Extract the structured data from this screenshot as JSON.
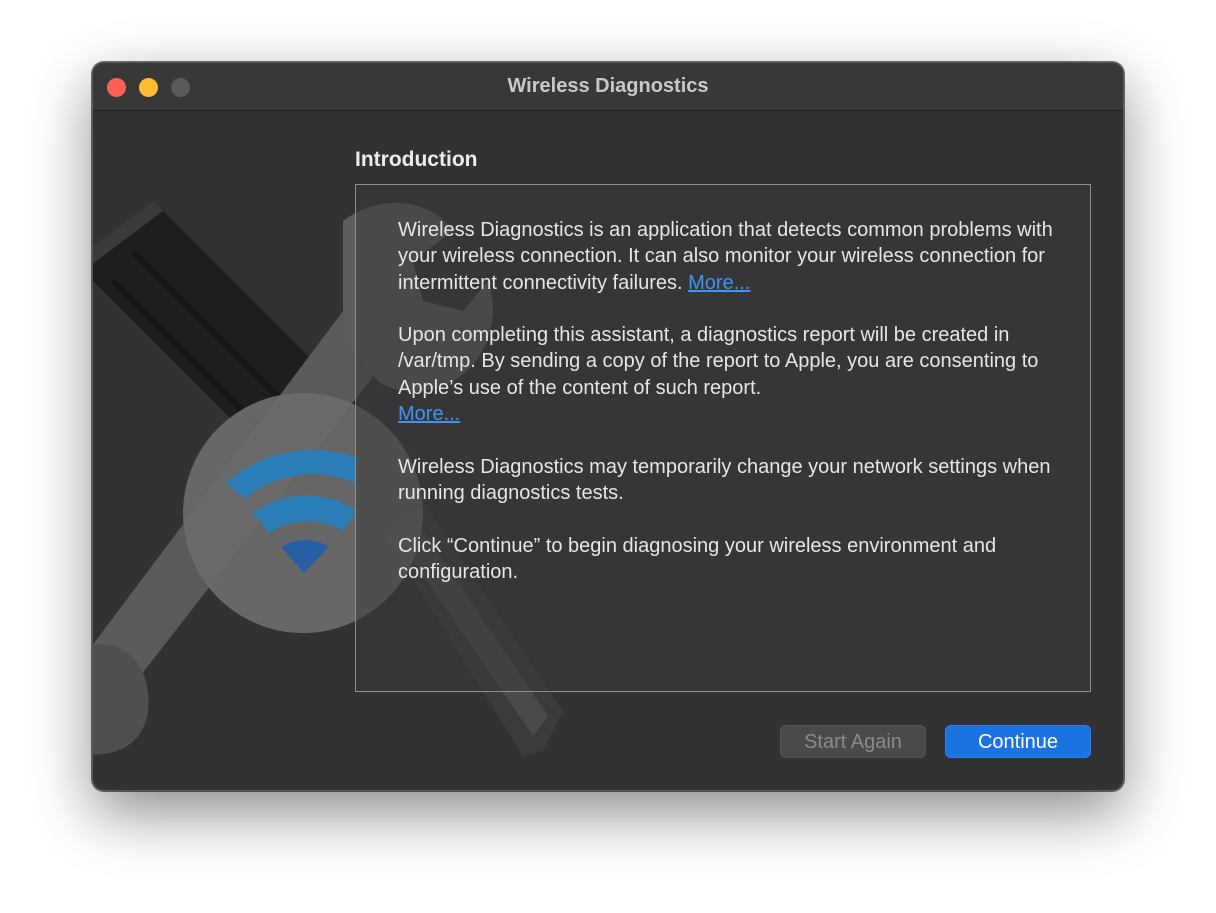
{
  "window": {
    "title": "Wireless Diagnostics"
  },
  "page": {
    "heading": "Introduction"
  },
  "intro": {
    "p1_text": "Wireless Diagnostics is an application that detects common problems with your wireless connection. It can also monitor your wireless connection for intermittent connectivity failures.",
    "p1_link": "More...",
    "p2_text": "Upon completing this assistant, a diagnostics report will be created in /var/tmp. By sending a copy of the report to Apple, you are consenting to Apple’s use of the content of such report.",
    "p2_link": "More...",
    "p3_text": "Wireless Diagnostics may temporarily change your network settings when running diagnostics tests.",
    "p4_text": "Click “Continue” to begin diagnosing your wireless environment and configuration."
  },
  "buttons": {
    "start_again": "Start Again",
    "continue": "Continue"
  },
  "icons": {
    "artwork": "wifi-wrench-screwdriver-icon"
  },
  "colors": {
    "accent": "#1a73e0",
    "link": "#3d94f6",
    "close": "#fe5f57",
    "minimize": "#febc2e"
  }
}
